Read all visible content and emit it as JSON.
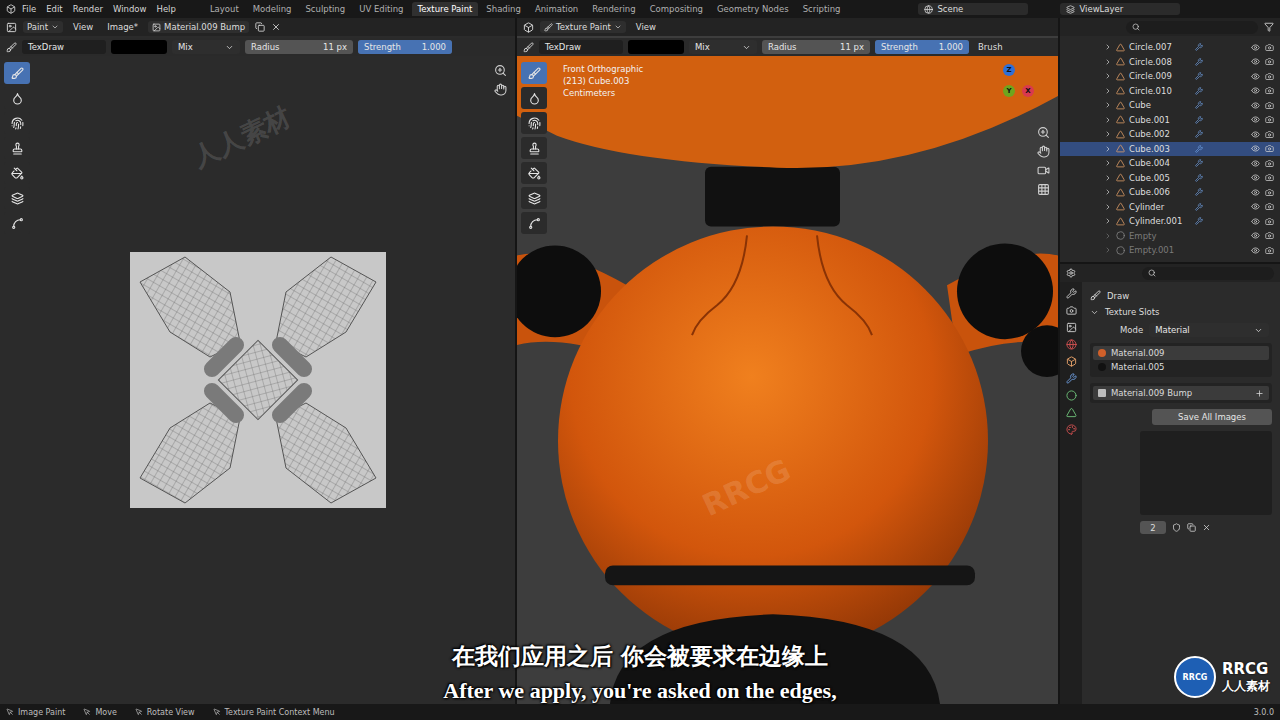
{
  "menu": [
    "File",
    "Edit",
    "Render",
    "Window",
    "Help"
  ],
  "workspaces": [
    {
      "label": "Layout",
      "selected": false
    },
    {
      "label": "Modeling",
      "selected": false
    },
    {
      "label": "Sculpting",
      "selected": false
    },
    {
      "label": "UV Editing",
      "selected": false
    },
    {
      "label": "Texture Paint",
      "selected": true
    },
    {
      "label": "Shading",
      "selected": false
    },
    {
      "label": "Animation",
      "selected": false
    },
    {
      "label": "Rendering",
      "selected": false
    },
    {
      "label": "Compositing",
      "selected": false
    },
    {
      "label": "Geometry Nodes",
      "selected": false
    },
    {
      "label": "Scripting",
      "selected": false
    }
  ],
  "scene": "Scene",
  "view_layer": "ViewLayer",
  "image_editor": {
    "header": {
      "mode": "Paint",
      "menus": [
        "View",
        "Image*"
      ],
      "image": "Material.009 Bump"
    },
    "tool_settings": {
      "brush": "TexDraw",
      "blend": "Mix",
      "radius_label": "Radius",
      "radius": "11 px",
      "strength_label": "Strength",
      "strength": "1.000",
      "strength_level": 1.0
    }
  },
  "viewport": {
    "header": {
      "mode": "Texture Paint",
      "menus": [
        "View"
      ]
    },
    "tool_settings": {
      "brush": "TexDraw",
      "blend": "Mix",
      "radius_label": "Radius",
      "radius": "11 px",
      "strength_label": "Strength",
      "strength": "1.000",
      "strength_level": 1.0,
      "extra": "Brush"
    },
    "overlay": [
      "Front Orthographic",
      "(213) Cube.003",
      "Centimeters"
    ],
    "axes": [
      {
        "label": "Z",
        "color": "#2f6fd6"
      },
      {
        "label": "Y",
        "color": "#6ea51e"
      },
      {
        "label": "X",
        "color": "#d9394e"
      }
    ]
  },
  "outliner": {
    "items": [
      {
        "name": "Circle.007",
        "kind": "mesh",
        "selected": false,
        "disabled": false
      },
      {
        "name": "Circle.008",
        "kind": "mesh",
        "selected": false,
        "disabled": false
      },
      {
        "name": "Circle.009",
        "kind": "mesh",
        "selected": false,
        "disabled": false
      },
      {
        "name": "Circle.010",
        "kind": "mesh",
        "selected": false,
        "disabled": false
      },
      {
        "name": "Cube",
        "kind": "mesh",
        "selected": false,
        "disabled": false
      },
      {
        "name": "Cube.001",
        "kind": "mesh",
        "selected": false,
        "disabled": false
      },
      {
        "name": "Cube.002",
        "kind": "mesh",
        "selected": false,
        "disabled": false
      },
      {
        "name": "Cube.003",
        "kind": "mesh",
        "selected": true,
        "disabled": false
      },
      {
        "name": "Cube.004",
        "kind": "mesh",
        "selected": false,
        "disabled": false
      },
      {
        "name": "Cube.005",
        "kind": "mesh",
        "selected": false,
        "disabled": false
      },
      {
        "name": "Cube.006",
        "kind": "mesh",
        "selected": false,
        "disabled": false
      },
      {
        "name": "Cylinder",
        "kind": "mesh",
        "selected": false,
        "disabled": false
      },
      {
        "name": "Cylinder.001",
        "kind": "mesh",
        "selected": false,
        "disabled": false
      },
      {
        "name": "Empty",
        "kind": "empty",
        "selected": false,
        "disabled": true
      },
      {
        "name": "Empty.001",
        "kind": "empty",
        "selected": false,
        "disabled": true
      }
    ]
  },
  "properties": {
    "brush": "Draw",
    "section": "Texture Slots",
    "mode_label": "Mode",
    "mode": "Material",
    "materials": [
      {
        "name": "Material.009",
        "selected": true
      },
      {
        "name": "Material.005",
        "selected": false
      }
    ],
    "slots": [
      {
        "name": "Material.009 Bump",
        "selected": true
      }
    ],
    "save_button": "Save All Images",
    "brush_users": "2"
  },
  "status_bar": {
    "items": [
      "Image Paint",
      "Move",
      "Rotate View",
      "Texture Paint Context Menu"
    ],
    "version": "3.0.0"
  },
  "subtitles": {
    "zh": "在我们应用之后 你会被要求在边缘上",
    "en": "After we apply, you're asked on the edges,"
  },
  "watermark": {
    "logo": "RRCG",
    "text": "人人素材"
  }
}
